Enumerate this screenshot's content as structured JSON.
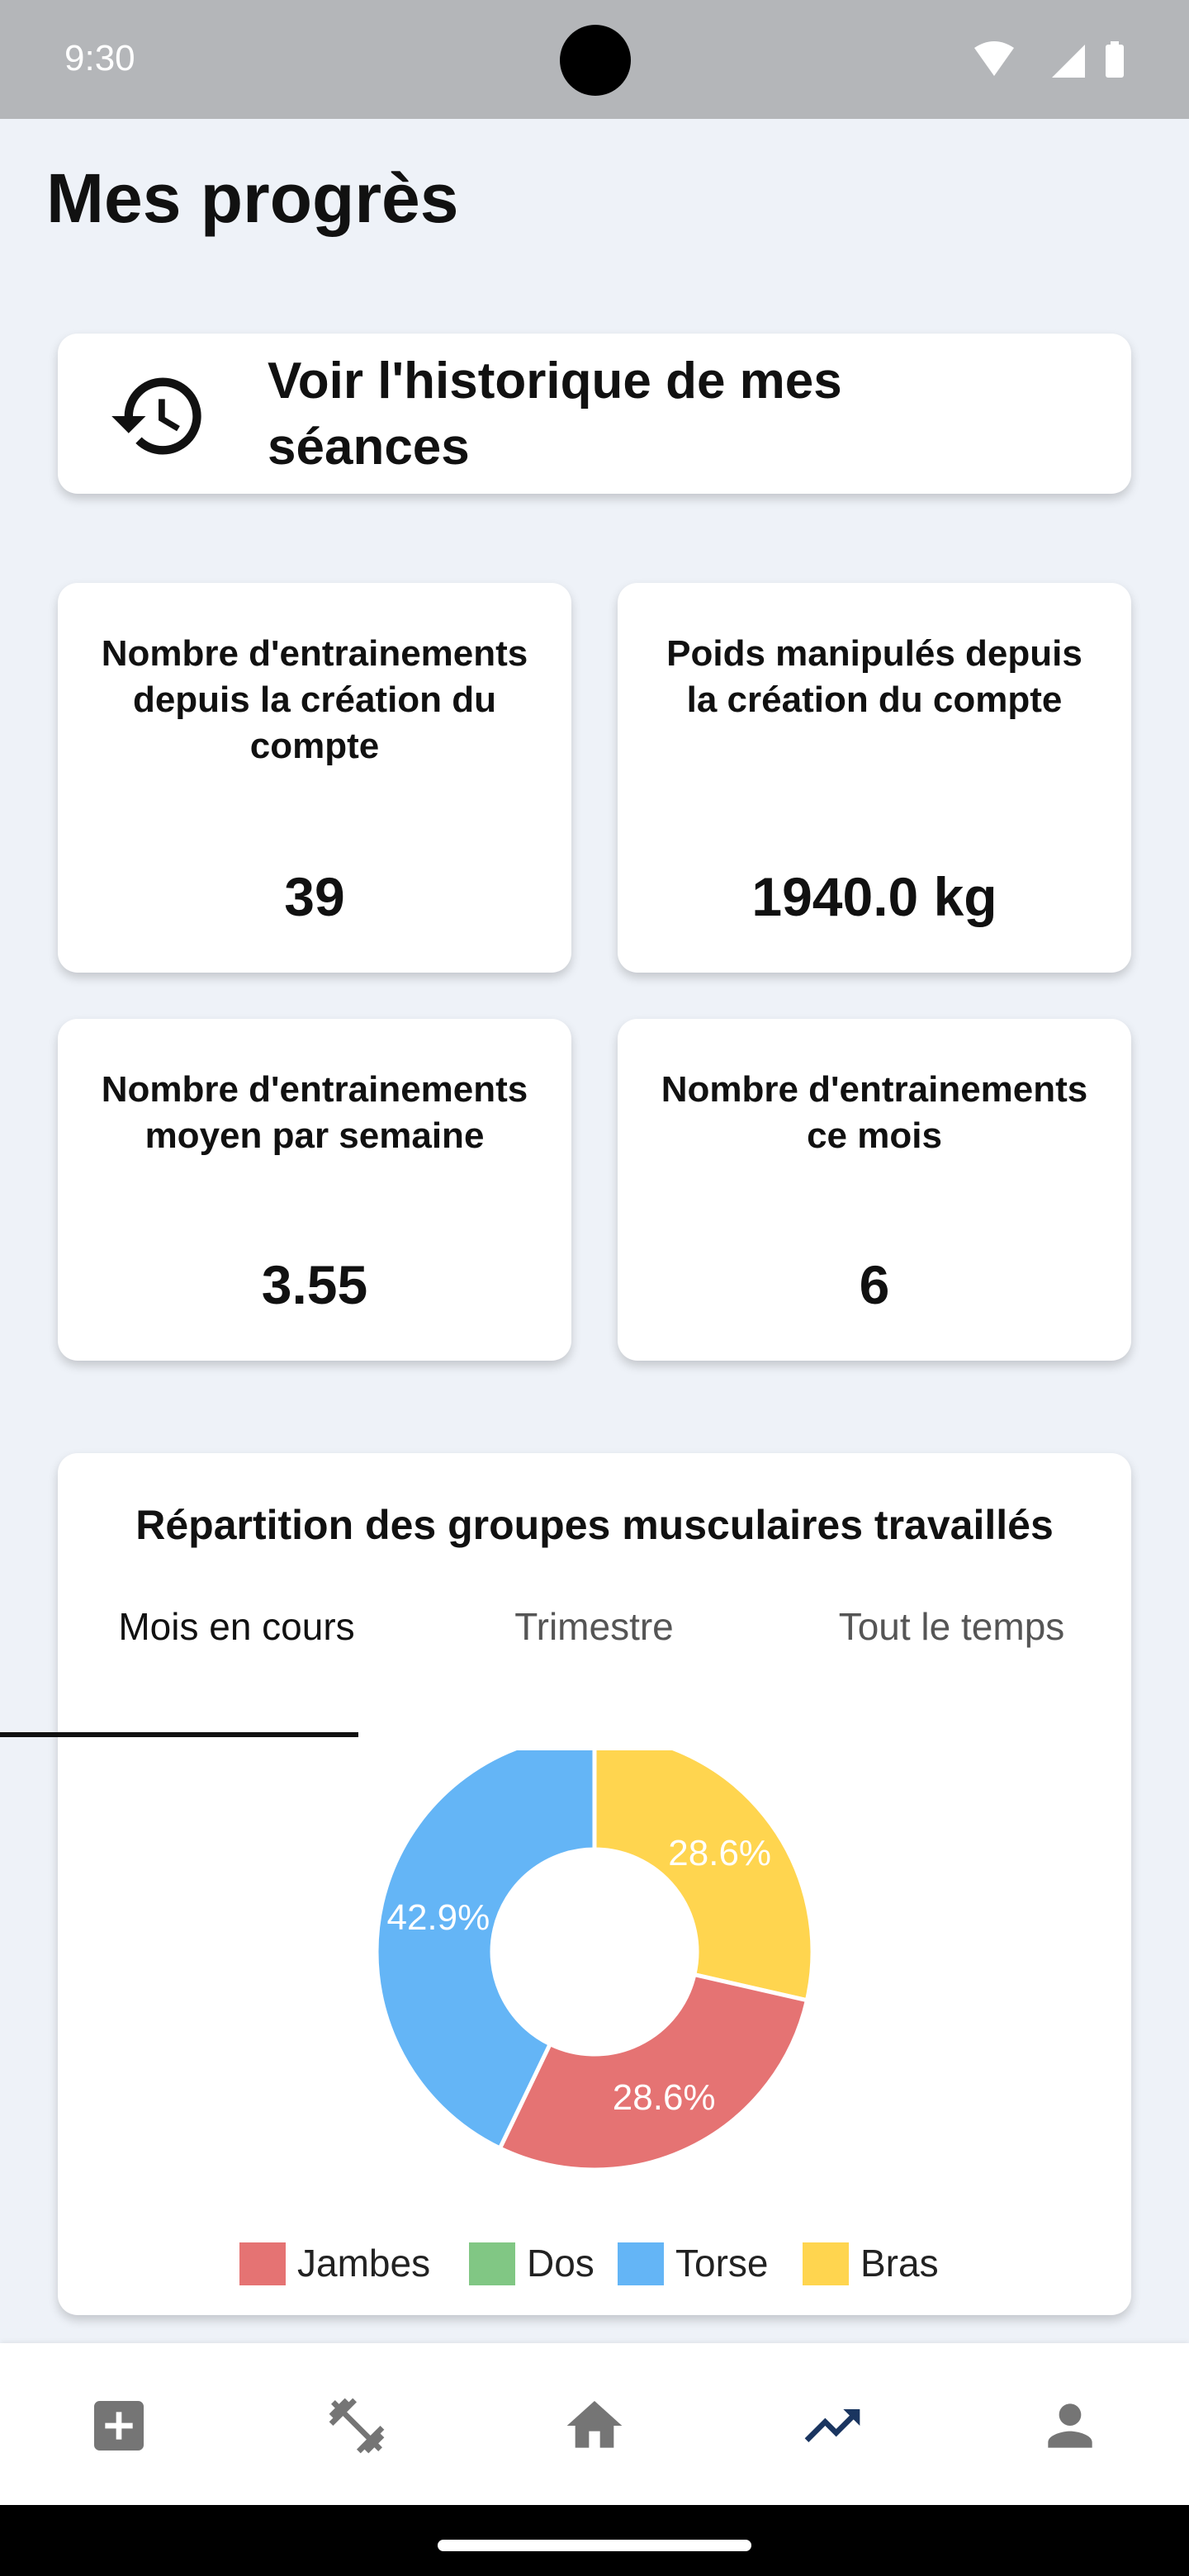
{
  "status_bar": {
    "time": "9:30"
  },
  "page": {
    "title": "Mes progrès"
  },
  "history": {
    "label": "Voir l'historique de mes séances"
  },
  "stats": {
    "total_workouts": {
      "label": "Nombre d'entrainements depuis la création du compte",
      "value": "39"
    },
    "total_weight": {
      "label": "Poids manipulés depuis la création du compte",
      "value": "1940.0 kg"
    },
    "weekly_avg": {
      "label": "Nombre d'entrainements moyen par semaine",
      "value": "3.55"
    },
    "this_month": {
      "label": "Nombre d'entrainements ce mois",
      "value": "6"
    }
  },
  "chart": {
    "title": "Répartition des groupes musculaires travaillés",
    "tabs": [
      "Mois en cours",
      "Trimestre",
      "Tout le temps"
    ],
    "active_tab": "Mois en cours"
  },
  "chart_data": {
    "type": "pie",
    "title": "Répartition des groupes musculaires travaillés",
    "categories": [
      "Jambes",
      "Dos",
      "Torse",
      "Bras"
    ],
    "values": [
      28.6,
      0,
      42.9,
      28.6
    ],
    "labels": [
      "28.6%",
      "",
      "42.9%",
      "28.6%"
    ],
    "colors": [
      "#e57373",
      "#81c784",
      "#64b5f6",
      "#ffd54f"
    ],
    "donut": true,
    "legend_position": "bottom"
  },
  "bottom_nav": {
    "items": [
      {
        "icon": "add-box-icon",
        "active": false
      },
      {
        "icon": "dumbbell-icon",
        "active": false
      },
      {
        "icon": "home-icon",
        "active": false
      },
      {
        "icon": "trending-up-icon",
        "active": true
      },
      {
        "icon": "person-icon",
        "active": false
      }
    ],
    "inactive_color": "#757575",
    "active_color": "#1a3560"
  }
}
